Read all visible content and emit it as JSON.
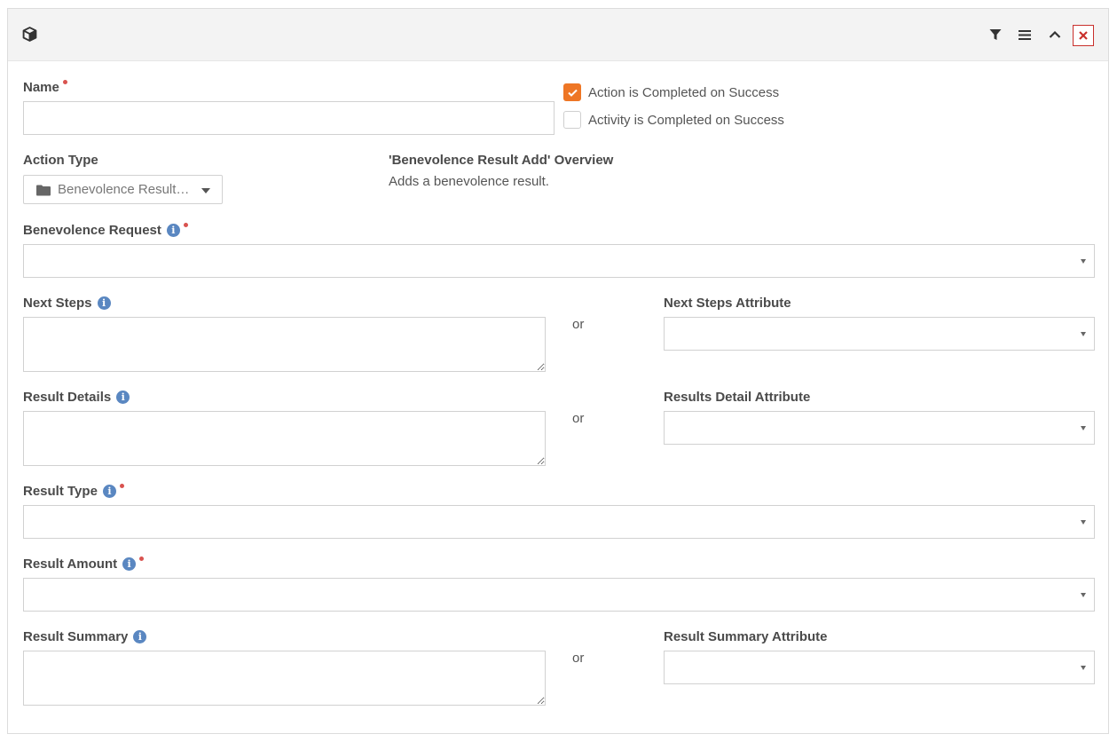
{
  "header": {
    "block_icon": "cube-icon",
    "actions": [
      {
        "name": "filter-icon"
      },
      {
        "name": "menu-icon"
      },
      {
        "name": "chevron-up-icon"
      },
      {
        "name": "close-icon"
      }
    ],
    "close_color": "#c9302c"
  },
  "form": {
    "name": {
      "label": "Name",
      "required": true,
      "value": ""
    },
    "checkboxes": [
      {
        "label": "Action is Completed on Success",
        "checked": true
      },
      {
        "label": "Activity is Completed on Success",
        "checked": false
      }
    ],
    "action_type": {
      "label": "Action Type",
      "value": "Benevolence Result Add",
      "icon": "folder-icon"
    },
    "overview": {
      "title": "'Benevolence Result Add' Overview",
      "text": "Adds a benevolence result."
    },
    "benevolence_request": {
      "label": "Benevolence Request",
      "required": true,
      "value": ""
    },
    "next_steps": {
      "label": "Next Steps",
      "value": ""
    },
    "next_steps_attribute": {
      "label": "Next Steps Attribute",
      "value": ""
    },
    "result_details": {
      "label": "Result Details",
      "value": ""
    },
    "results_detail_attribute": {
      "label": "Results Detail Attribute",
      "value": ""
    },
    "result_type": {
      "label": "Result Type",
      "required": true,
      "value": ""
    },
    "result_amount": {
      "label": "Result Amount",
      "required": true,
      "value": ""
    },
    "result_summary": {
      "label": "Result Summary",
      "value": ""
    },
    "result_summary_attribute": {
      "label": "Result Summary Attribute",
      "value": ""
    },
    "or_text": "or"
  },
  "colors": {
    "accent": "#ee7625",
    "info": "#5a87c1",
    "required": "#d9534f",
    "header_bg": "#f3f3f3"
  }
}
